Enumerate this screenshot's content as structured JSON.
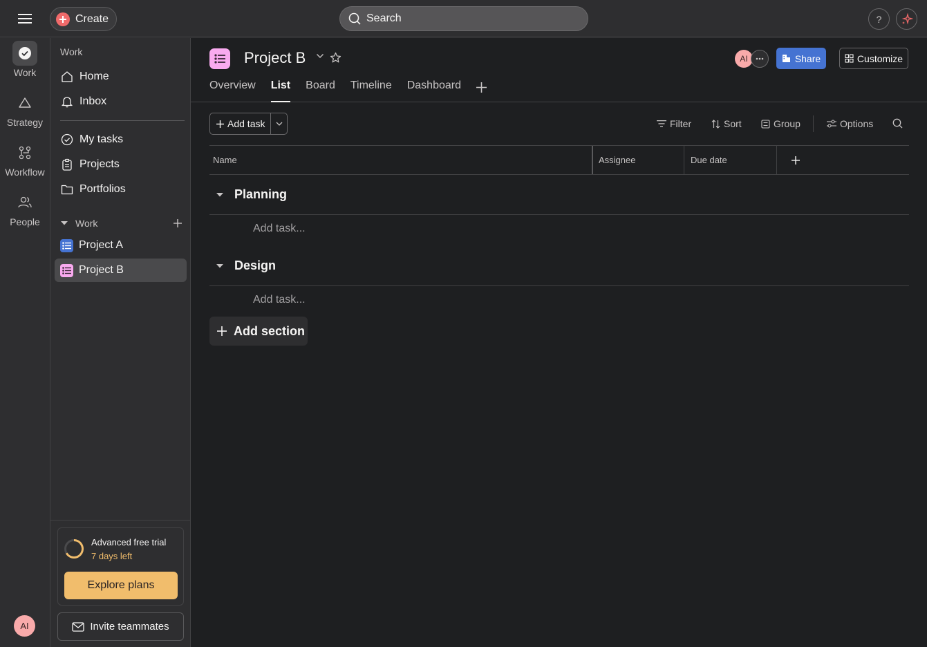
{
  "topbar": {
    "create_label": "Create",
    "search_placeholder": "Search",
    "help_label": "?"
  },
  "rail": {
    "items": [
      {
        "label": "Work",
        "icon": "check-circle-icon"
      },
      {
        "label": "Strategy",
        "icon": "triangle-icon"
      },
      {
        "label": "Workflow",
        "icon": "workflow-icon"
      },
      {
        "label": "People",
        "icon": "people-icon"
      }
    ],
    "avatar": "AI"
  },
  "sidebar": {
    "heading": "Work",
    "top_items": [
      {
        "label": "Home",
        "icon": "home-icon"
      },
      {
        "label": "Inbox",
        "icon": "bell-icon"
      }
    ],
    "mid_items": [
      {
        "label": "My tasks",
        "icon": "check-circle-icon"
      },
      {
        "label": "Projects",
        "icon": "clipboard-icon"
      },
      {
        "label": "Portfolios",
        "icon": "folder-icon"
      }
    ],
    "team_label": "Work",
    "projects": [
      {
        "label": "Project A",
        "color": "#4573d2"
      },
      {
        "label": "Project B",
        "color": "#f9aaef"
      }
    ],
    "trial": {
      "title": "Advanced free trial",
      "days_left": "7 days left",
      "explore_label": "Explore plans"
    },
    "invite_label": "Invite teammates"
  },
  "project": {
    "title": "Project B",
    "avatar": "AI",
    "share_label": "Share",
    "customize_label": "Customize",
    "tabs": [
      "Overview",
      "List",
      "Board",
      "Timeline",
      "Dashboard"
    ],
    "active_tab": "List"
  },
  "toolbar": {
    "add_task_label": "Add task",
    "filter_label": "Filter",
    "sort_label": "Sort",
    "group_label": "Group",
    "options_label": "Options"
  },
  "columns": [
    "Name",
    "Assignee",
    "Due date"
  ],
  "sections": [
    {
      "title": "Planning",
      "add_task": "Add task..."
    },
    {
      "title": "Design",
      "add_task": "Add task..."
    }
  ],
  "add_section_label": "Add section",
  "colors": {
    "accent_blue": "#4573d2",
    "create_red": "#f06a6a",
    "trial_orange": "#f1bd6c",
    "project_pink": "#f9aaef",
    "avatar_pink": "#f9aaaa"
  }
}
